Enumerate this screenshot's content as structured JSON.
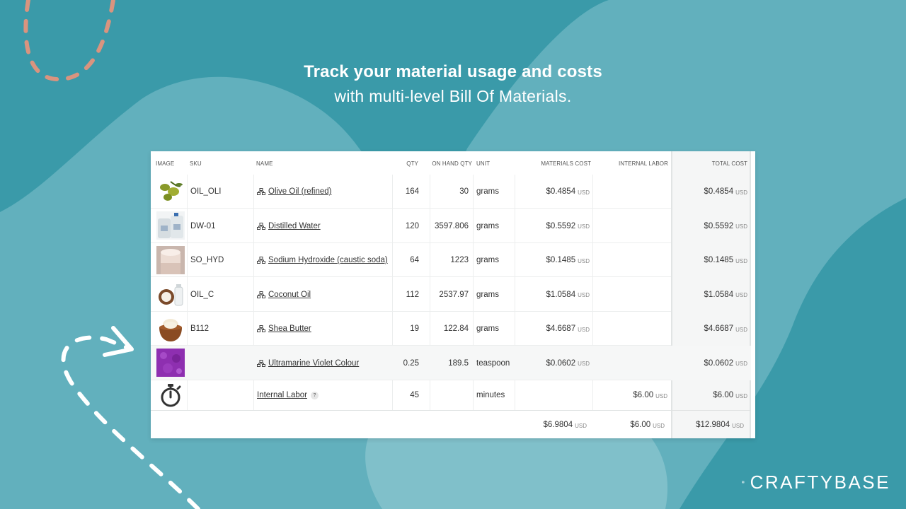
{
  "headline": {
    "line1": "Track your material usage and costs",
    "line2": "with multi-level Bill Of Materials."
  },
  "colors": {
    "background": "#3a9aa9",
    "blob_light": "#62b0bd",
    "dash_salmon": "#d9947f",
    "dash_white": "#ffffff"
  },
  "table": {
    "headers": {
      "image": "IMAGE",
      "sku": "SKU",
      "name": "NAME",
      "qty": "QTY",
      "on_hand": "ON HAND QTY",
      "unit": "UNIT",
      "materials_cost": "MATERIALS COST",
      "internal_labor": "INTERNAL LABOR",
      "total_cost": "TOTAL COST"
    },
    "currency": "USD",
    "rows": [
      {
        "image": "olives-image",
        "sku": "OIL_OLI",
        "name": "Olive Oil (refined)",
        "qty": "164",
        "on_hand": "30",
        "unit": "grams",
        "materials_cost": "$0.4854",
        "internal_labor": "",
        "total_cost": "$0.4854"
      },
      {
        "image": "water-jugs-image",
        "sku": "DW-01",
        "name": "Distilled Water",
        "qty": "120",
        "on_hand": "3597.806",
        "unit": "grams",
        "materials_cost": "$0.5592",
        "internal_labor": "",
        "total_cost": "$0.5592"
      },
      {
        "image": "caustic-soda-image",
        "sku": "SO_HYD",
        "name": "Sodium Hydroxide (caustic soda)",
        "qty": "64",
        "on_hand": "1223",
        "unit": "grams",
        "materials_cost": "$0.1485",
        "internal_labor": "",
        "total_cost": "$0.1485"
      },
      {
        "image": "coconut-image",
        "sku": "OIL_C",
        "name": "Coconut Oil",
        "qty": "112",
        "on_hand": "2537.97",
        "unit": "grams",
        "materials_cost": "$1.0584",
        "internal_labor": "",
        "total_cost": "$1.0584"
      },
      {
        "image": "shea-butter-image",
        "sku": "B112",
        "name": "Shea Butter",
        "qty": "19",
        "on_hand": "122.84",
        "unit": "grams",
        "materials_cost": "$4.6687",
        "internal_labor": "",
        "total_cost": "$4.6687"
      },
      {
        "image": "violet-powder-image",
        "sku": "",
        "name": "Ultramarine Violet Colour",
        "qty": "0.25",
        "on_hand": "189.5",
        "unit": "teaspoon",
        "materials_cost": "$0.0602",
        "internal_labor": "",
        "total_cost": "$0.0602"
      }
    ],
    "labor_row": {
      "icon": "stopwatch-icon",
      "name": "Internal Labor",
      "help": "?",
      "qty": "45",
      "unit": "minutes",
      "internal_labor": "$6.00",
      "total_cost": "$6.00"
    },
    "totals": {
      "materials_cost": "$6.9804",
      "internal_labor": "$6.00",
      "total_cost": "$12.9804"
    }
  },
  "logo": {
    "icon": "craftybase-cube-icon",
    "text": "CRAFTYBASE"
  }
}
